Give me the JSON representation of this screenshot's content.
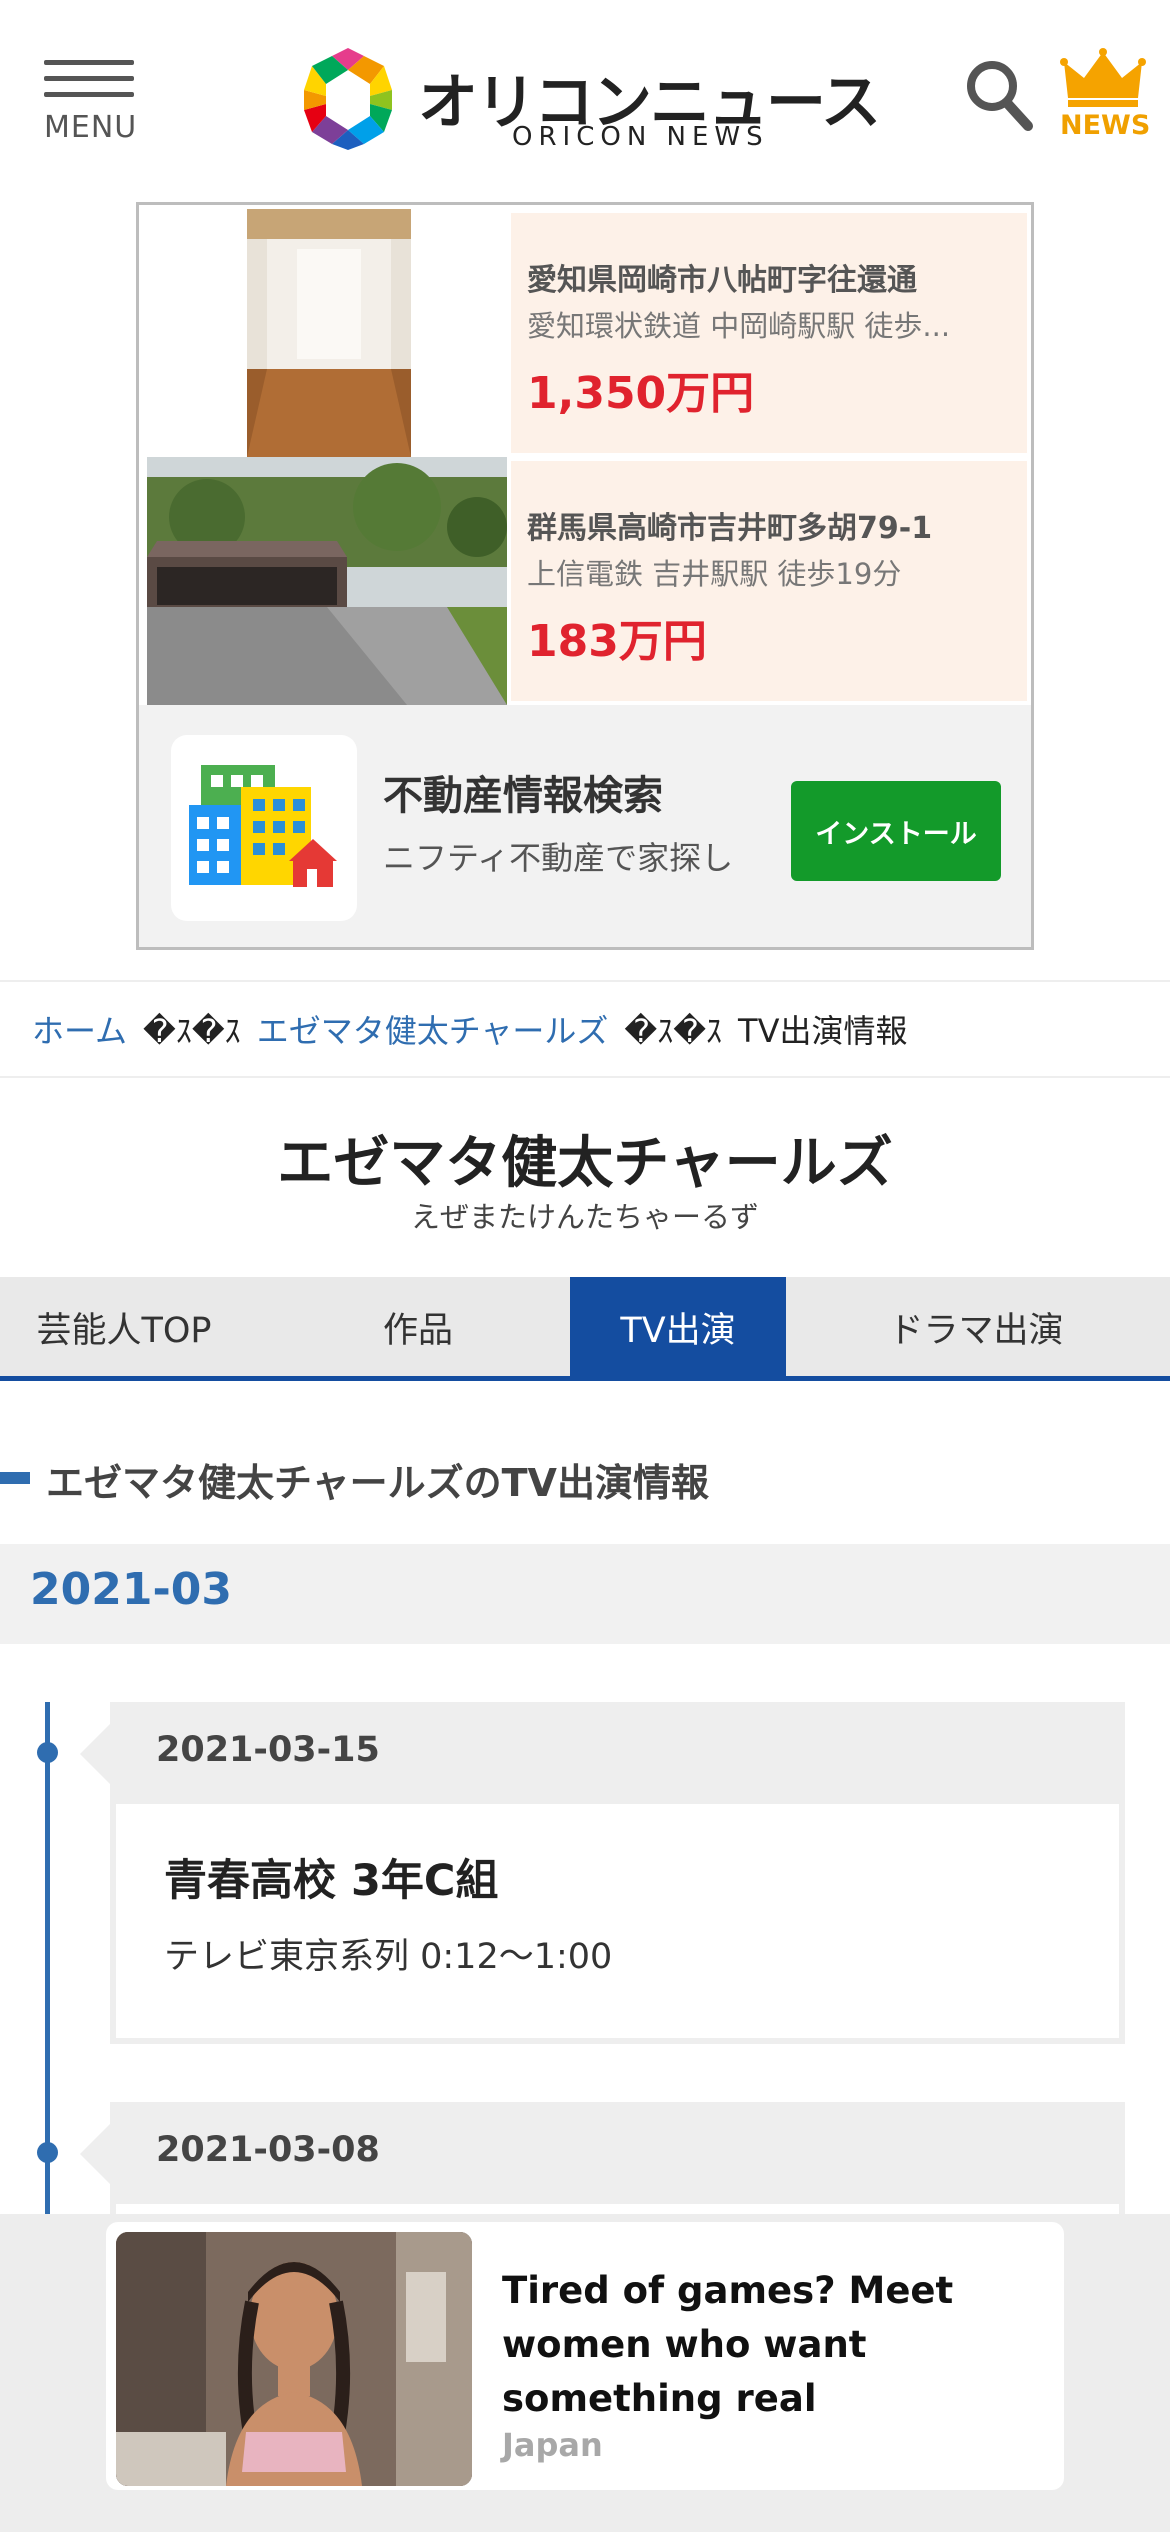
{
  "header": {
    "menu_label": "MENU",
    "logo_jp": "オリコンニュース",
    "logo_en": "ORICON NEWS",
    "news_label": "NEWS"
  },
  "ad_top": {
    "listings": [
      {
        "title": "愛知県岡崎市八帖町字往還通",
        "sub": "愛知環状鉄道 中岡崎駅駅 徒歩...",
        "price": "1,350万円"
      },
      {
        "title": "群馬県高崎市吉井町多胡79-1",
        "sub": "上信電鉄 吉井駅駅 徒歩19分",
        "price": "183万円"
      }
    ],
    "app_title": "不動産情報検索",
    "app_sub": "ニフティ不動産で家探し",
    "install_label": "インストール"
  },
  "breadcrumb": {
    "home": "ホーム",
    "sep": "�ｽ�ｽ",
    "artist": "エゼマタ健太チャールズ",
    "current": "TV出演情報"
  },
  "artist": {
    "name": "エゼマタ健太チャールズ",
    "kana": "えぜまたけんたちゃーるず"
  },
  "tabs": [
    {
      "label": "芸能人TOP"
    },
    {
      "label": "作品"
    },
    {
      "label": "TV出演"
    },
    {
      "label": "ドラマ出演"
    }
  ],
  "section": {
    "title": "エゼマタ健太チャールズのTV出演情報",
    "month": "2021-03"
  },
  "entries": [
    {
      "date": "2021-03-15",
      "title": "青春高校 3年C組",
      "sub": "テレビ東京系列 0:12〜1:00"
    },
    {
      "date": "2021-03-08"
    }
  ],
  "bottom_ad": {
    "title": "Tired of games? Meet women who want something real",
    "source": "Japan"
  },
  "colors": {
    "accent_blue": "#144da0",
    "link_blue": "#2f6db0",
    "price_red": "#e0232e",
    "install_green": "#139a2a",
    "news_gold": "#f0a000"
  }
}
